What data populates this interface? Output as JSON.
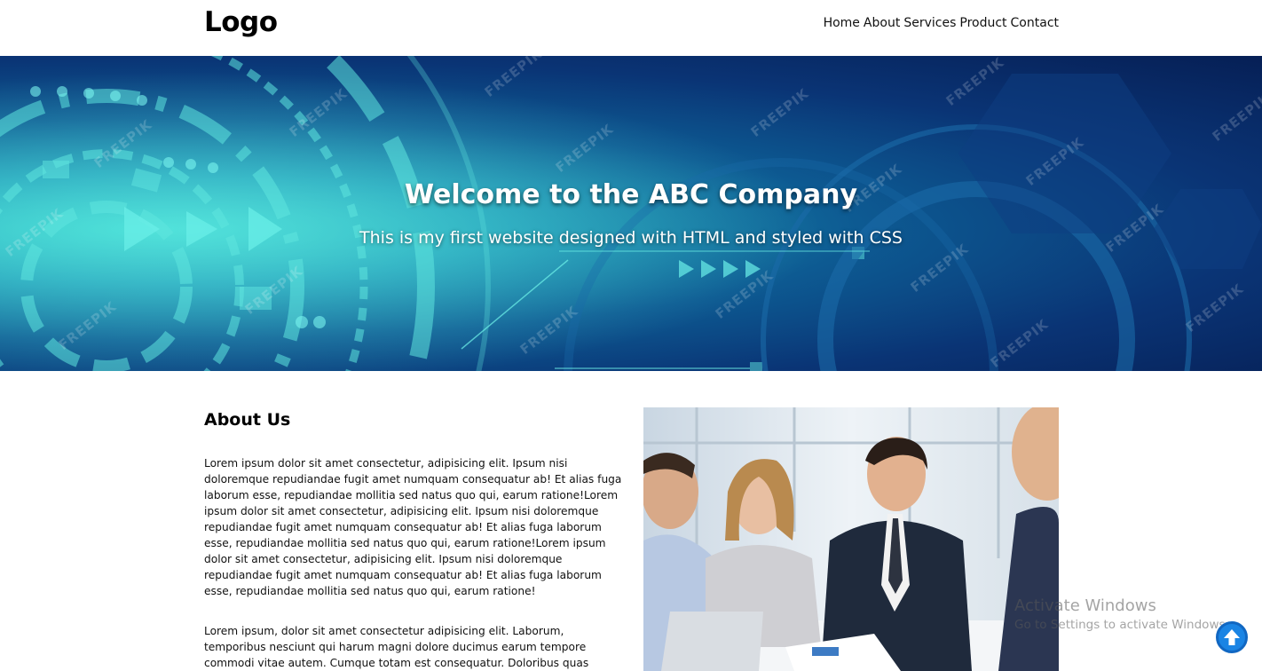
{
  "header": {
    "logo": "Logo",
    "nav": [
      "Home",
      "About",
      "Services",
      "Product",
      "Contact"
    ]
  },
  "hero": {
    "title": "Welcome to the ABC Company",
    "subtitle": "This is my first website designed with HTML and styled with CSS",
    "watermark": "FREEPIK"
  },
  "about": {
    "title": "About Us",
    "paragraph1": "Lorem ipsum dolor sit amet consectetur, adipisicing elit. Ipsum nisi doloremque repudiandae fugit amet numquam consequatur ab! Et alias fuga laborum esse, repudiandae mollitia sed natus quo qui, earum ratione!Lorem ipsum dolor sit amet consectetur, adipisicing elit. Ipsum nisi doloremque repudiandae fugit amet numquam consequatur ab! Et alias fuga laborum esse, repudiandae mollitia sed natus quo qui, earum ratione!Lorem ipsum dolor sit amet consectetur, adipisicing elit. Ipsum nisi doloremque repudiandae fugit amet numquam consequatur ab! Et alias fuga laborum esse, repudiandae mollitia sed natus quo qui, earum ratione!",
    "paragraph2": "Lorem ipsum, dolor sit amet consectetur adipisicing elit. Laborum, temporibus nesciunt qui harum magni dolore ducimus earum tempore commodi vitae autem. Cumque totam est consequatur. Doloribus quas tempora hic debitis?"
  },
  "overlay": {
    "activate_title": "Activate Windows",
    "activate_sub": "Go to Settings to activate Windows."
  },
  "icons": {
    "scroll_top": "arrow-up-circle-icon"
  },
  "colors": {
    "hero_dark": "#061f55",
    "hero_teal": "#2fd0c8",
    "scroll_button": "#1a84e4"
  }
}
